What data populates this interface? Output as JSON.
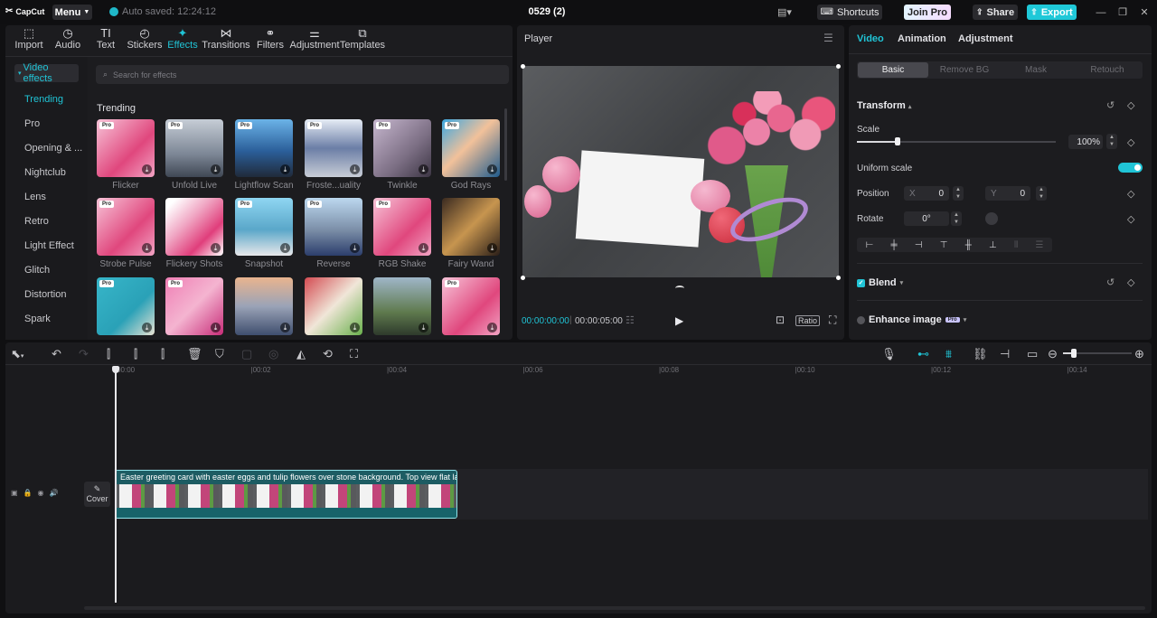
{
  "topbar": {
    "logo": "CapCut",
    "menu": "Menu",
    "autosave": "Auto saved: 12:24:12",
    "project_title": "0529 (2)",
    "shortcuts": "Shortcuts",
    "join_pro": "Join Pro",
    "share": "Share",
    "export": "Export"
  },
  "tools": [
    {
      "label": "Import",
      "icon": "import-icon"
    },
    {
      "label": "Audio",
      "icon": "audio-icon"
    },
    {
      "label": "Text",
      "icon": "text-icon"
    },
    {
      "label": "Stickers",
      "icon": "sticker-icon"
    },
    {
      "label": "Effects",
      "icon": "effects-icon"
    },
    {
      "label": "Transitions",
      "icon": "transitions-icon"
    },
    {
      "label": "Filters",
      "icon": "filters-icon"
    },
    {
      "label": "Adjustment",
      "icon": "adjustment-icon"
    },
    {
      "label": "Templates",
      "icon": "templates-icon"
    }
  ],
  "sidebar": {
    "head": "Video effects",
    "items": [
      "Trending",
      "Pro",
      "Opening & ...",
      "Nightclub",
      "Lens",
      "Retro",
      "Light Effect",
      "Glitch",
      "Distortion",
      "Spark"
    ]
  },
  "effects": {
    "search_placeholder": "Search for effects",
    "section_title": "Trending",
    "items": [
      {
        "name": "Flicker",
        "pro": "Pro"
      },
      {
        "name": "Unfold Live",
        "pro": "Pro"
      },
      {
        "name": "Lightflow Scan",
        "pro": "Pro"
      },
      {
        "name": "Froste...uality",
        "pro": "Pro"
      },
      {
        "name": "Twinkle",
        "pro": "Pro"
      },
      {
        "name": "God Rays",
        "pro": "Pro"
      },
      {
        "name": "Strobe Pulse",
        "pro": "Pro"
      },
      {
        "name": "Flickery Shots",
        "pro": ""
      },
      {
        "name": "Snapshot",
        "pro": "Pro"
      },
      {
        "name": "Reverse",
        "pro": "Pro"
      },
      {
        "name": "RGB Shake",
        "pro": "Pro"
      },
      {
        "name": "Fairy Wand",
        "pro": ""
      },
      {
        "name": "",
        "pro": "Pro"
      },
      {
        "name": "",
        "pro": "Pro"
      },
      {
        "name": "",
        "pro": ""
      },
      {
        "name": "",
        "pro": ""
      },
      {
        "name": "",
        "pro": ""
      },
      {
        "name": "",
        "pro": "Pro"
      }
    ]
  },
  "player": {
    "title": "Player",
    "current_time": "00:00:00:00",
    "total_time": "00:00:05:00",
    "ratio": "Ratio"
  },
  "properties": {
    "tabs": [
      "Video",
      "Animation",
      "Adjustment"
    ],
    "subtabs": [
      "Basic",
      "Remove BG",
      "Mask",
      "Retouch"
    ],
    "transform": "Transform",
    "scale_label": "Scale",
    "scale_value": "100%",
    "uniform_scale": "Uniform scale",
    "position_label": "Position",
    "pos_x_label": "X",
    "pos_x": "0",
    "pos_y_label": "Y",
    "pos_y": "0",
    "rotate_label": "Rotate",
    "rotate_value": "0°",
    "blend": "Blend",
    "enhance_image": "Enhance image",
    "pro_badge": "Pro"
  },
  "timeline": {
    "ticks": [
      "00:00",
      "00:02",
      "00:04",
      "00:06",
      "00:08",
      "00:10",
      "00:12",
      "00:14"
    ],
    "clip_title": "Easter greeting card with easter eggs and tulip flowers over stone background. Top view flat la",
    "cover": "Cover"
  },
  "colors": {
    "accent": "#20c4d6",
    "export": "#1fc8d8",
    "clip_border": "#8fe3e9"
  }
}
